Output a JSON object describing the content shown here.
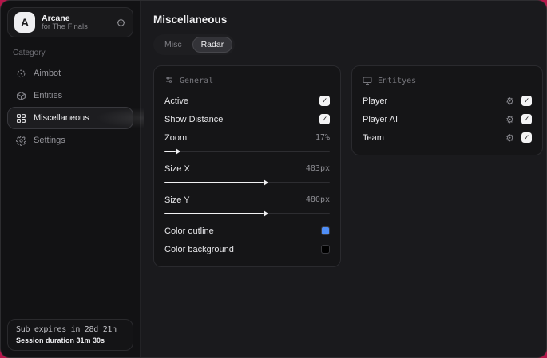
{
  "app": {
    "logo_letter": "A",
    "name": "Arcane",
    "subtitle": "for The Finals"
  },
  "sidebar": {
    "category_label": "Category",
    "items": [
      {
        "label": "Aimbot",
        "active": false
      },
      {
        "label": "Entities",
        "active": false
      },
      {
        "label": "Miscellaneous",
        "active": true
      },
      {
        "label": "Settings",
        "active": false
      }
    ],
    "footer": {
      "sub_expires": "Sub expires in 28d 21h",
      "session_duration": "Session duration 31m 30s"
    }
  },
  "main": {
    "title": "Miscellaneous",
    "tabs": [
      {
        "label": "Misc",
        "active": false
      },
      {
        "label": "Radar",
        "active": true
      }
    ],
    "general": {
      "title": "General",
      "active_label": "Active",
      "active_checked": true,
      "show_distance_label": "Show Distance",
      "show_distance_checked": true,
      "zoom_label": "Zoom",
      "zoom_value": "17%",
      "zoom_fill_percent": 7,
      "size_x_label": "Size X",
      "size_x_value": "483px",
      "size_x_fill_percent": 60,
      "size_y_label": "Size Y",
      "size_y_value": "480px",
      "size_y_fill_percent": 60,
      "color_outline_label": "Color outline",
      "color_outline_value": "#4f8ef7",
      "color_background_label": "Color background",
      "color_background_value": "#000000"
    },
    "entities": {
      "title": "Entityes",
      "rows": [
        {
          "label": "Player",
          "checked": true
        },
        {
          "label": "Player AI",
          "checked": true
        },
        {
          "label": "Team",
          "checked": true
        }
      ]
    }
  }
}
